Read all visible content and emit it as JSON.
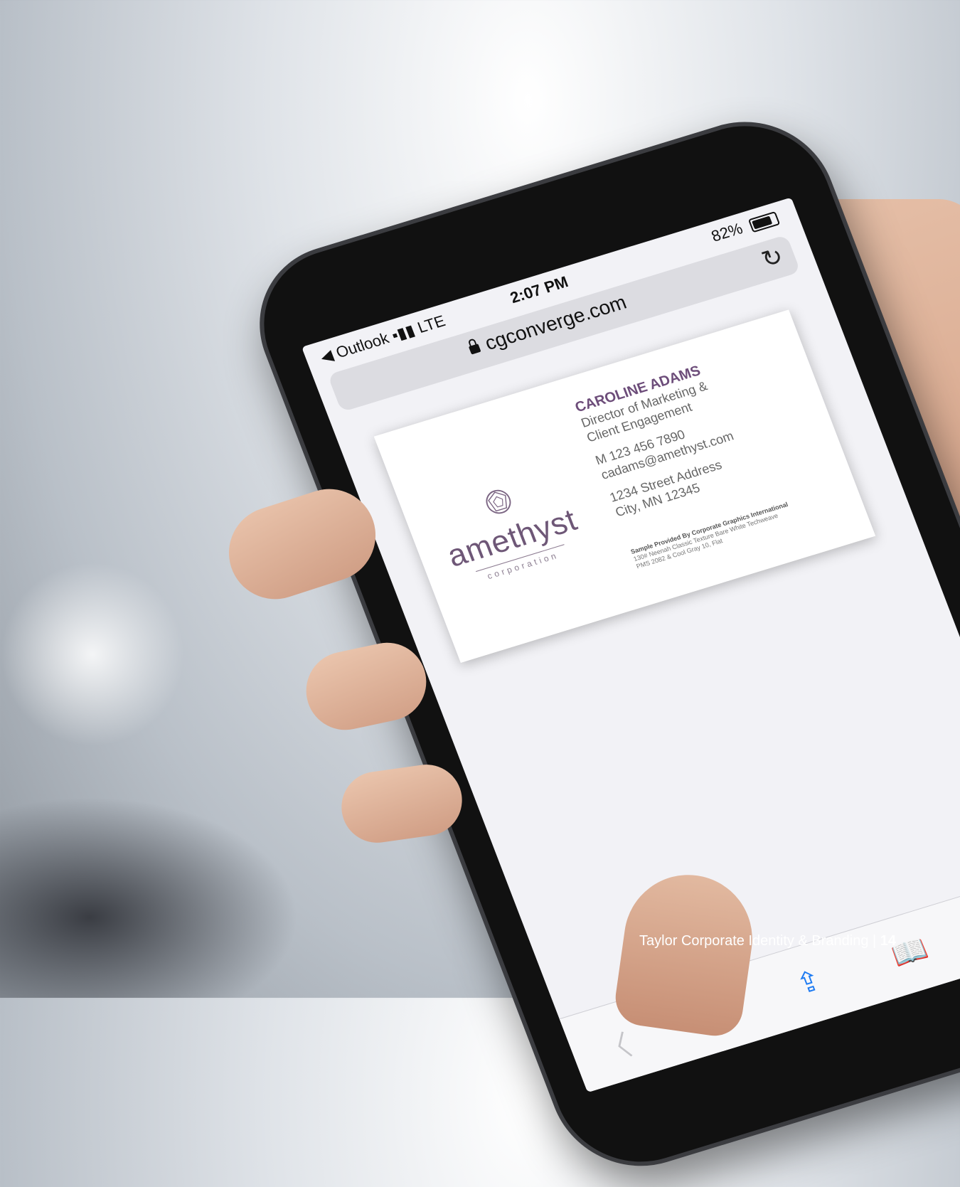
{
  "status_bar": {
    "carrier": "◀ Outlook ▪▮▮ LTE",
    "time": "2:07 PM",
    "battery": "82%"
  },
  "browser": {
    "url": "cgconverge.com"
  },
  "card": {
    "logo_word": "amethyst",
    "logo_sub": "corporation",
    "name": "CAROLINE ADAMS",
    "title_line1": "Director of Marketing &",
    "title_line2": "Client Engagement",
    "phone": "M  123 456 7890",
    "email": "cadams@amethyst.com",
    "address1": "1234 Street Address",
    "address2": "City, MN 12345",
    "fine1": "Sample Provided By Corporate Graphics International",
    "fine2": "130# Neenah Classic Texture Bare White Techweave",
    "fine3": "PMS 2082 & Cool Gray 10, Flat"
  },
  "toolbar": {
    "back": "〈",
    "forward": "〉",
    "share": "⇪",
    "bookmarks": "📖",
    "tabs": "⧉"
  },
  "footer": {
    "text": "Taylor Corporate Identity & Branding  |  ",
    "page": "14"
  },
  "colors": {
    "accent": "#1e7bf2",
    "brand": "#6d4d7a"
  }
}
